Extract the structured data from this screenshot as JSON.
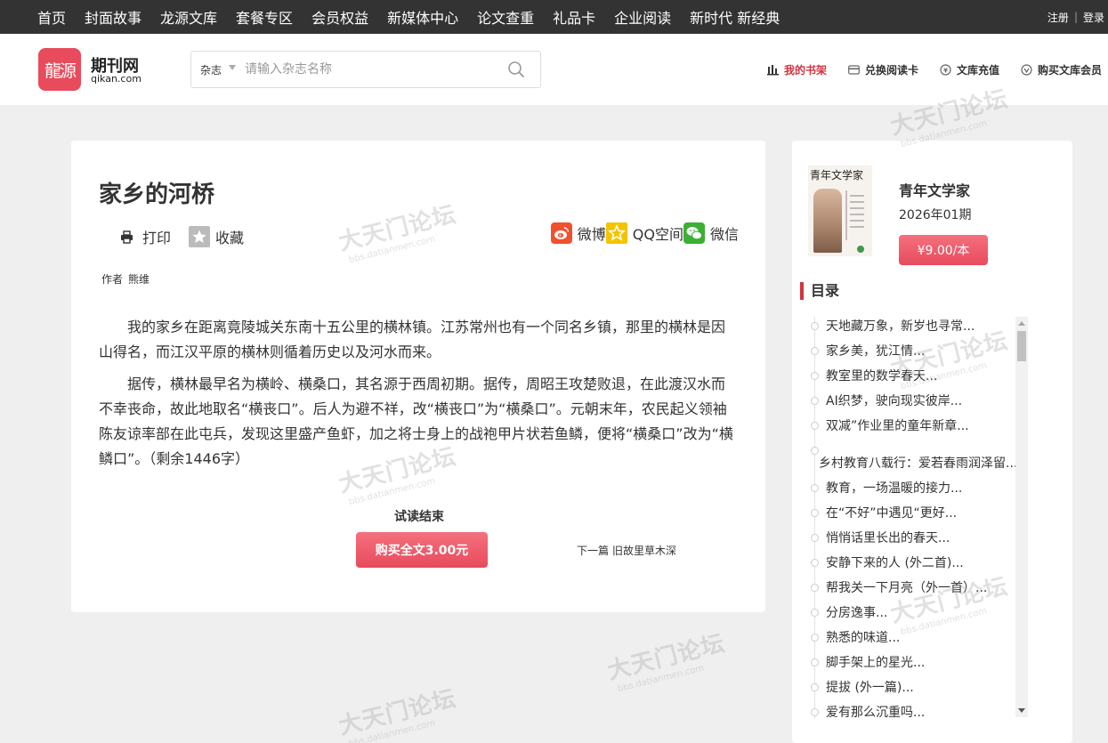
{
  "topnav": {
    "items": [
      "首页",
      "封面故事",
      "龙源文库",
      "套餐专区",
      "会员权益",
      "新媒体中心",
      "论文查重",
      "礼品卡",
      "企业阅读",
      "新时代 新经典"
    ],
    "register": "注册",
    "separator": "|",
    "login": "登录"
  },
  "header": {
    "logo_mark": "龍源",
    "logo_name": "期刊网",
    "logo_domain": "qikan.com",
    "search_category": "杂志",
    "search_placeholder": "请输入杂志名称",
    "links": [
      "我的书架",
      "兑换阅读卡",
      "文库充值",
      "购买文库会员"
    ]
  },
  "article": {
    "title": "家乡的河桥",
    "print": "打印",
    "favorite": "收藏",
    "share": {
      "weibo": "微博",
      "qzone": "QQ空间",
      "wechat": "微信"
    },
    "author_label": "作者",
    "author_name": "熊维",
    "paragraphs": [
      "我的家乡在距离竟陵城关东南十五公里的横林镇。江苏常州也有一个同名乡镇，那里的横林是因山得名，而江汉平原的横林则循着历史以及河水而来。",
      "据传，横林最早名为横岭、横桑口，其名源于西周初期。据传，周昭王攻楚败退，在此渡汉水而不幸丧命，故此地取名“横丧口”。后人为避不祥，改“横丧口”为“横桑口”。元朝末年，农民起义领袖陈友谅率部在此屯兵，发现这里盛产鱼虾，加之将士身上的战袍甲片状若鱼鳞，便将“横桑口”改为“横鳞口”。（剩余1446字）"
    ],
    "trial_end": "试读结束",
    "buy_full": "购买全文3.00元",
    "next_label": "下一篇",
    "next_title": "旧故里草木深"
  },
  "sidebar": {
    "cover_masthead": "青年文学家",
    "magazine": "青年文学家",
    "issue": "2026年01期",
    "price": "¥9.00/本",
    "toc_title": "目录",
    "toc": [
      "天地藏万象，新岁也寻常...",
      "家乡美，犹江情...",
      "教室里的数学春天...",
      "AI织梦，驶向现实彼岸...",
      "双减”作业里的童年新章...",
      "乡村教育八载行：爱若春雨润泽留...",
      "教育，一场温暖的接力...",
      "在“不好”中遇见“更好...",
      "悄悄话里长出的春天...",
      "安静下来的人 (外二首)...",
      "帮我关一下月亮（外一首）...",
      "分房逸事...",
      "熟悉的味道...",
      "脚手架上的星光...",
      "提拔 (外一篇)...",
      "爱有那么沉重吗..."
    ]
  },
  "watermark": {
    "text": "大天门论坛",
    "domain": "bbs.datianmen.com"
  },
  "colors": {
    "brand": "#e84b5c",
    "accent_red": "#d0343f",
    "topbar": "#333333"
  }
}
